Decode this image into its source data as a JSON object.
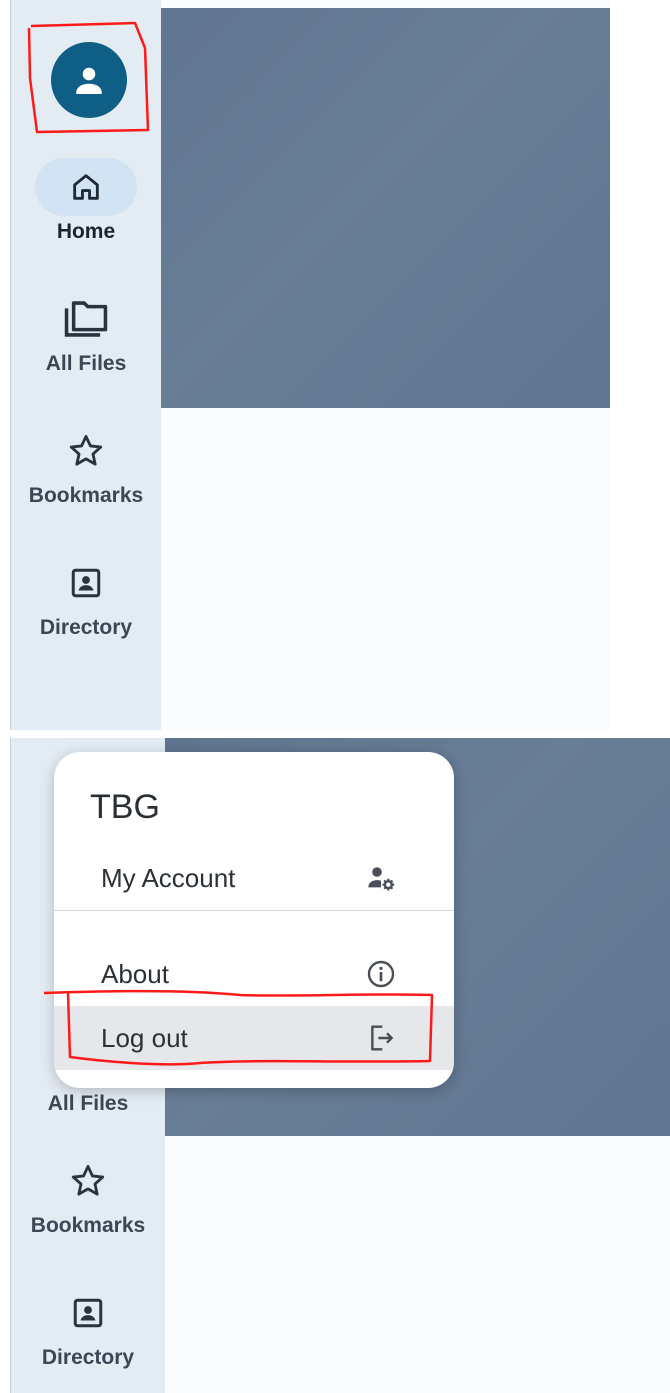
{
  "sidebar": {
    "items": [
      {
        "label": "Home",
        "active": true
      },
      {
        "label": "All Files",
        "active": false
      },
      {
        "label": "Bookmarks",
        "active": false
      },
      {
        "label": "Directory",
        "active": false
      }
    ]
  },
  "account_menu": {
    "title": "TBG",
    "items": [
      {
        "label": "My Account",
        "icon": "manage-account-icon"
      },
      {
        "label": "About",
        "icon": "info-icon"
      },
      {
        "label": "Log out",
        "icon": "logout-icon",
        "highlighted": true
      }
    ]
  },
  "colors": {
    "sidebar_bg": "#e3ecf3",
    "avatar_bg": "#0e5e86",
    "active_pill": "#d2e3f3",
    "hero_bg": "#637891",
    "annotation": "#ff1a1a"
  }
}
